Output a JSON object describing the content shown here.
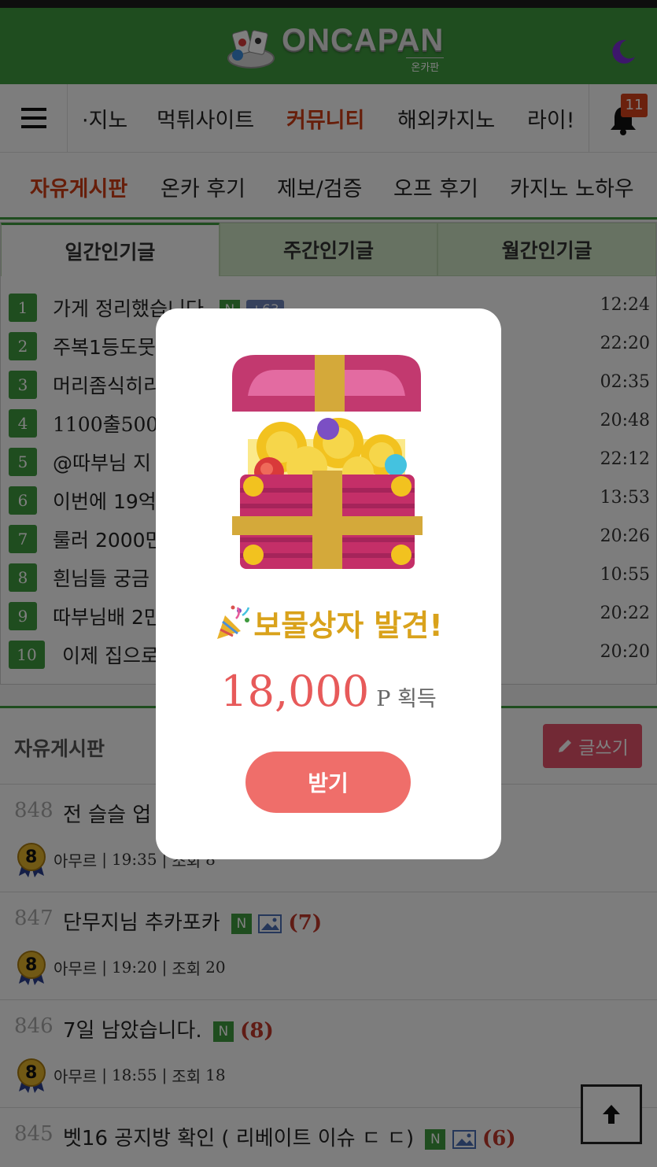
{
  "header": {
    "logo_title": "ONCAPAN",
    "logo_sub": "온카판",
    "notification_count": "11"
  },
  "nav": {
    "items": [
      "·지노",
      "먹튀사이트",
      "커뮤니티",
      "해외카지노",
      "라이!"
    ],
    "active": "커뮤니티"
  },
  "subnav": {
    "items": [
      "자유게시판",
      "온카 후기",
      "제보/검증",
      "오프 후기",
      "카지노 노하우"
    ],
    "active": "자유게시판"
  },
  "popular": {
    "tabs": [
      "일간인기글",
      "주간인기글",
      "월간인기글"
    ],
    "rows": [
      {
        "rank": "1",
        "title": "가게 정리했습니다",
        "new": "N",
        "plus": "+63",
        "time": "12:24"
      },
      {
        "rank": "2",
        "title": "주복1등도뭇",
        "time": "22:20"
      },
      {
        "rank": "3",
        "title": "머리좀식히리",
        "time": "02:35"
      },
      {
        "rank": "4",
        "title": "1100출5000",
        "time": "20:48"
      },
      {
        "rank": "5",
        "title": "@따부님 지",
        "time": "22:12"
      },
      {
        "rank": "6",
        "title": "이번에 19억",
        "time": "13:53"
      },
      {
        "rank": "7",
        "title": "룰러 2000만",
        "time": "20:26"
      },
      {
        "rank": "8",
        "title": "흰님들 궁금",
        "time": "10:55"
      },
      {
        "rank": "9",
        "title": "따부님배 2만",
        "time": "20:22"
      },
      {
        "rank": "10",
        "title": "이제 집으로",
        "time": "20:20"
      }
    ]
  },
  "board": {
    "title": "자유게시판",
    "write_label": "글쓰기",
    "posts": [
      {
        "num": "848",
        "title": "전 슬슬 업",
        "author": "아무르",
        "time": "19:35",
        "views_label": "조회",
        "views": "8"
      },
      {
        "num": "847",
        "title": "단무지님 추카포카",
        "new": "N",
        "comments": "(7)",
        "author": "아무르",
        "time": "19:20",
        "views_label": "조회",
        "views": "20"
      },
      {
        "num": "846",
        "title": "7일 남았습니다.",
        "new": "N",
        "comments": "(8)",
        "author": "아무르",
        "time": "18:55",
        "views_label": "조회",
        "views": "18"
      },
      {
        "num": "845",
        "title": "벳16 공지방 확인 ( 리베이트 이슈 ㄷ ㄷ)",
        "new": "N",
        "comments": "(6)"
      }
    ],
    "level_badge": "8"
  },
  "modal": {
    "title": "보물상자 발견!",
    "amount": "18,000",
    "unit_p": "P",
    "unit_word": "획득",
    "button": "받기"
  },
  "colors": {
    "brand_green": "#3f9a3f",
    "active_red": "#cf3d14",
    "accent_pink": "#e5536a",
    "modal_gold": "#d9a21b",
    "modal_amount": "#e75a5a",
    "modal_button": "#ef6e6a"
  },
  "icons": [
    "menu-icon",
    "moon-icon",
    "bell-icon",
    "pencil-icon",
    "image-icon",
    "arrow-up-icon",
    "treasure-chest-icon",
    "party-popper-icon",
    "level-medal-icon"
  ]
}
